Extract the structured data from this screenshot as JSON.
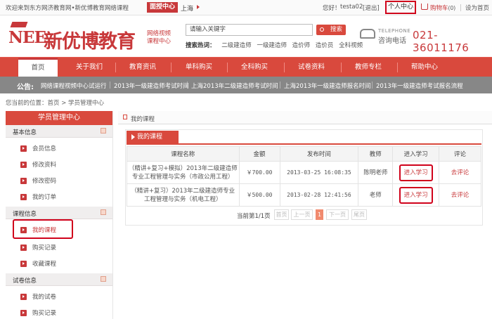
{
  "topbar": {
    "welcome": "欢迎来到东方网济教育网•新优博教育网络课程",
    "region_label": "面授中心",
    "city": "上海",
    "greeting": "您好！",
    "username": "testa02",
    "logout": "[退出]",
    "user_center": "个人中心",
    "cart": "购物车",
    "cart_count": "(0)",
    "set_home": "设为首页"
  },
  "header": {
    "logo_en": "NEE",
    "logo_cn": "新优博教育",
    "slogan_line1": "网络视频",
    "slogan_line2": "课程中心",
    "search_placeholder": "请输入关键字",
    "search_button": "搜索",
    "hot_label": "搜索热词：",
    "hot_words": [
      "二级建造师",
      "一级建造师",
      "造价师",
      "造价员",
      "全科视频"
    ],
    "phone_en": "TELEPHONE",
    "phone_cn": "咨询电话",
    "phone_number": "021-36011176"
  },
  "nav": {
    "items": [
      "首页",
      "关于我们",
      "教育资讯",
      "单科购买",
      "全科购买",
      "试卷资料",
      "教师专栏",
      "帮助中心"
    ],
    "active": "首页"
  },
  "announce": {
    "label": "公告:",
    "items": [
      "网络课程视频中心试运行",
      "2013年一级建造师考试时间",
      "上海2013年二级建造师考试时间",
      "上海2013年一级建造师报名时间",
      "2013年一级建造师考试报名流程"
    ]
  },
  "breadcrumb": {
    "text": "您当前的位置：首页 > 学员管理中心"
  },
  "sidebar": {
    "title": "学员管理中心",
    "group_basic": "基本信息",
    "basic_items": [
      "会员信息",
      "修改资料",
      "修改密码",
      "我的订单"
    ],
    "group_course": "课程信息",
    "course_items": [
      "我的课程",
      "购买记录",
      "收藏课程"
    ],
    "group_exam": "试卷信息",
    "exam_items": [
      "我的试卷",
      "购买记录"
    ]
  },
  "main": {
    "panel_title": "我的课程",
    "tab_label": "我的课程",
    "columns": [
      "课程名称",
      "金额",
      "发布时间",
      "教师",
      "进入学习",
      "评论"
    ],
    "rows": [
      {
        "name_line1": "（精讲+复习+模拟）2013年二级建造师",
        "name_line2": "专业工程管理与实务（市政公用工程）",
        "price": "￥700.00",
        "time": "2013-03-25 16:08:35",
        "teacher": "陈明老师",
        "action": "进入学习",
        "comment": "去评论"
      },
      {
        "name_line1": "（精讲+复习）2013年二级建造师专业",
        "name_line2": "工程管理与实务（机电工程）",
        "price": "￥500.00",
        "time": "2013-02-28 12:41:56",
        "teacher": "老师",
        "action": "进入学习",
        "comment": "去评论"
      }
    ],
    "pager": {
      "text": "当前第1/1页",
      "first": "首页",
      "prev": "上一页",
      "current": "1",
      "next": "下一页",
      "last": "尾页"
    }
  },
  "colors": {
    "brand_red": "#d9493d",
    "highlight": "#d0021b",
    "announce_gray": "#878787"
  }
}
